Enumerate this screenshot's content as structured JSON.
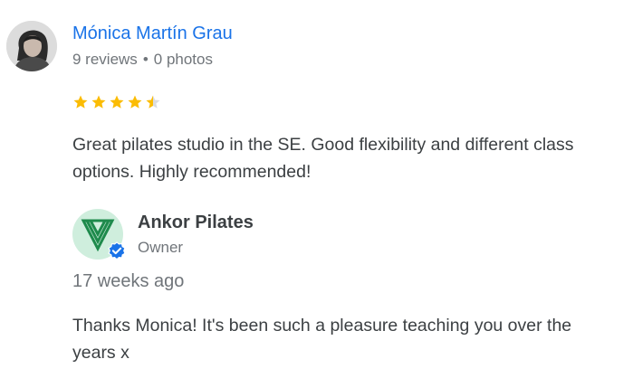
{
  "reviewer": {
    "name": "Mónica Martín Grau",
    "reviews": "9 reviews",
    "separator": "•",
    "photos": "0 photos",
    "avatar_icon": "profile-photo"
  },
  "rating": {
    "value": 4.5,
    "max": 5,
    "star_color": "#fbbc04"
  },
  "review_text": "Great pilates studio in the SE. Good flexibility and different class options. Highly recommended!",
  "owner_reply": {
    "name": "Ankor Pilates",
    "role": "Owner",
    "time": "17 weeks ago",
    "text": "Thanks Monica! It's been such a pleasure teaching you over the years x",
    "logo_icon": "ankor-pilates-logo",
    "badge_icon": "verified-check-icon",
    "logo_color": "#1e8a4c",
    "logo_bg": "#cfeedd",
    "badge_color": "#1a73e8"
  }
}
